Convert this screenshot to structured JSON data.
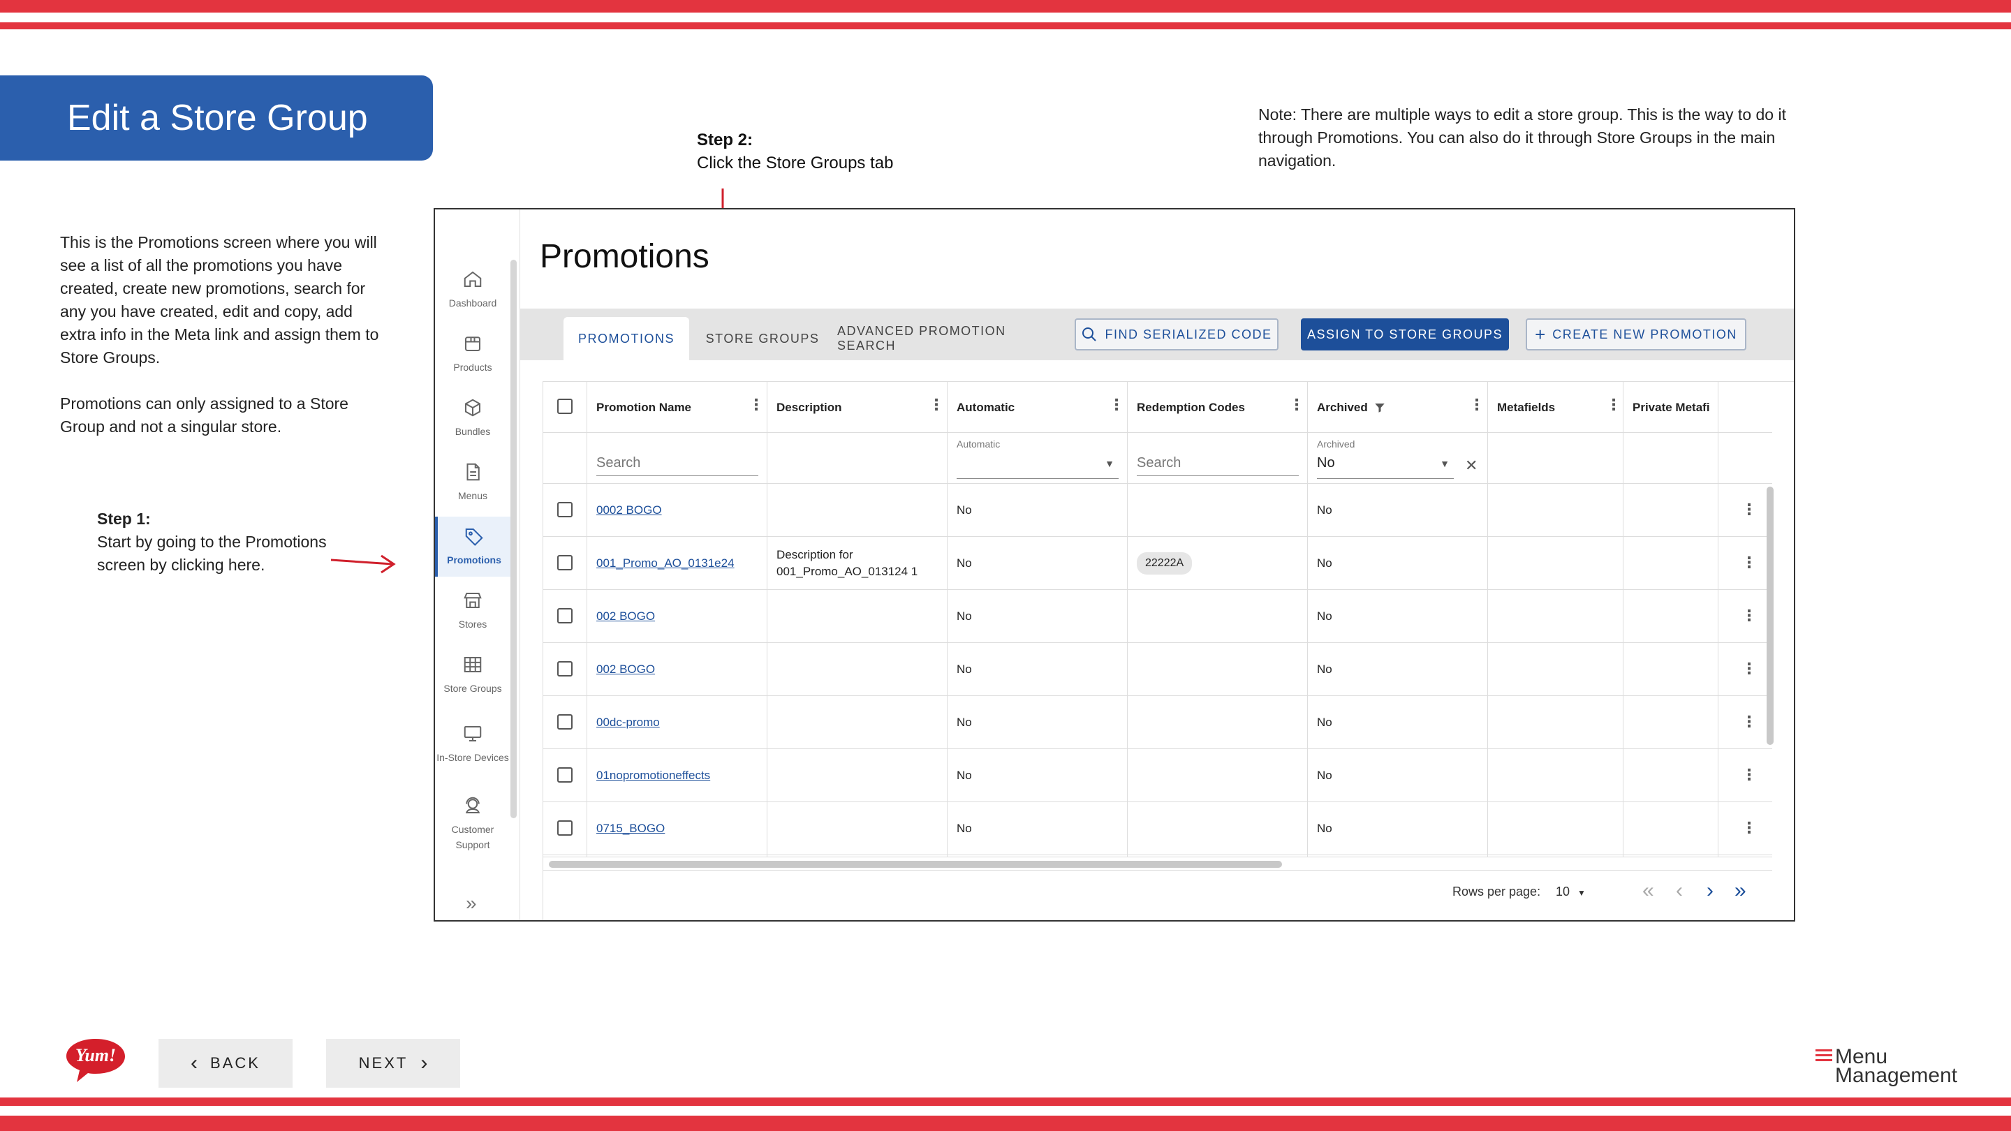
{
  "slide": {
    "title": "Edit a Store Group",
    "step2_heading": "Step 2:",
    "step2_text": "Click the Store Groups tab",
    "note": "Note: There are multiple ways to edit a store group. This is the way to do it through Promotions. You can also do it through Store Groups in the main navigation.",
    "description_1": "This is the Promotions screen where you will see a list of all the promotions you have created, create new promotions, search for any you have created, edit and copy, add extra info in the Meta link and assign them to Store Groups.",
    "description_2": "Promotions can only assigned to a Store Group and not a singular store.",
    "step1_heading": "Step 1:",
    "step1_text": "Start by going to the Promotions screen by clicking here.",
    "back_label": "BACK",
    "next_label": "NEXT",
    "yum_logo": "Yum!",
    "mm_logo_line1": "Menu",
    "mm_logo_line2": "Management",
    "accent_color": "#e3343f",
    "banner_color": "#2b5fad"
  },
  "sidebar": {
    "items": [
      {
        "label": "Dashboard",
        "icon": "home-icon"
      },
      {
        "label": "Products",
        "icon": "box-icon"
      },
      {
        "label": "Bundles",
        "icon": "cube-icon"
      },
      {
        "label": "Menus",
        "icon": "document-icon"
      },
      {
        "label": "Promotions",
        "icon": "tag-icon",
        "active": true
      },
      {
        "label": "Stores",
        "icon": "store-icon"
      },
      {
        "label": "Store Groups",
        "icon": "grid-icon"
      },
      {
        "label": "In-Store Devices",
        "icon": "monitor-icon"
      },
      {
        "label": "Customer Support",
        "icon": "support-icon"
      }
    ],
    "collapse_glyph": "»"
  },
  "main": {
    "title": "Promotions",
    "tabs": [
      "PROMOTIONS",
      "STORE GROUPS",
      "ADVANCED PROMOTION SEARCH"
    ],
    "find_button": "FIND SERIALIZED CODE",
    "assign_button": "ASSIGN TO STORE GROUPS",
    "create_button": "CREATE NEW PROMOTION"
  },
  "table": {
    "columns": [
      "Promotion Name",
      "Description",
      "Automatic",
      "Redemption Codes",
      "Archived",
      "Metafields",
      "Private Metafi"
    ],
    "filters": {
      "name_placeholder": "Search",
      "automatic_label": "Automatic",
      "codes_placeholder": "Search",
      "archived_label": "Archived",
      "archived_value": "No"
    },
    "rows": [
      {
        "name": "0002 BOGO",
        "description": "",
        "automatic": "No",
        "codes": "",
        "archived": "No"
      },
      {
        "name": "001_Promo_AO_0131e24",
        "description": "Description for 001_Promo_AO_013124 1",
        "automatic": "No",
        "codes": "22222A",
        "archived": "No"
      },
      {
        "name": "002 BOGO",
        "description": "",
        "automatic": "No",
        "codes": "",
        "archived": "No"
      },
      {
        "name": "002 BOGO",
        "description": "",
        "automatic": "No",
        "codes": "",
        "archived": "No"
      },
      {
        "name": "00dc-promo",
        "description": "",
        "automatic": "No",
        "codes": "",
        "archived": "No"
      },
      {
        "name": "01nopromotioneffects",
        "description": "",
        "automatic": "No",
        "codes": "",
        "archived": "No"
      },
      {
        "name": "0715_BOGO",
        "description": "",
        "automatic": "No",
        "codes": "",
        "archived": "No"
      }
    ]
  },
  "pagination": {
    "rows_per_page_label": "Rows per page:",
    "rows_per_page_value": "10"
  }
}
